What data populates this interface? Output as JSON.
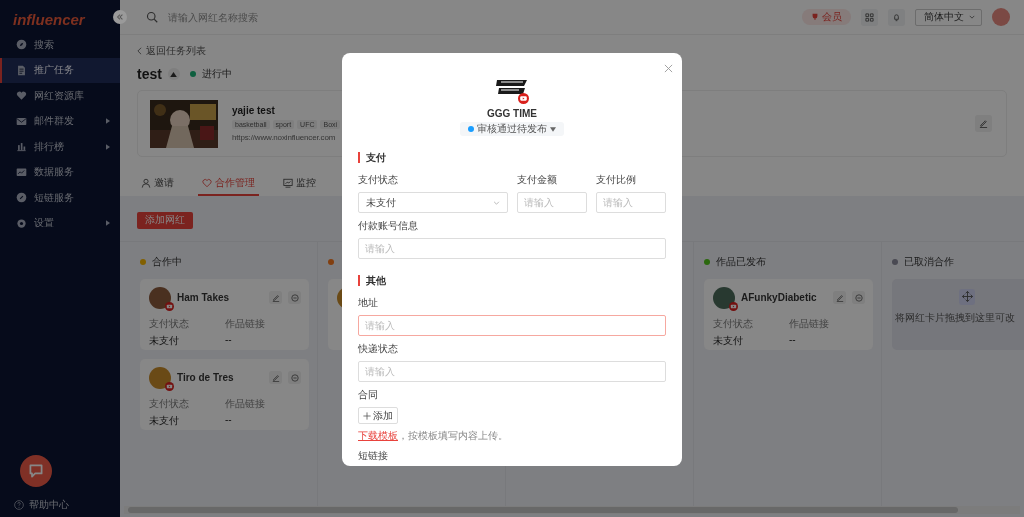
{
  "sidebar": {
    "logo": "influencer",
    "items": [
      {
        "label": "搜索",
        "selected": false,
        "has_submenu": false
      },
      {
        "label": "推广任务",
        "selected": true,
        "has_submenu": false
      },
      {
        "label": "网红资源库",
        "selected": false,
        "has_submenu": false
      },
      {
        "label": "邮件群发",
        "selected": false,
        "has_submenu": true
      },
      {
        "label": "排行榜",
        "selected": false,
        "has_submenu": true
      },
      {
        "label": "数据服务",
        "selected": false,
        "has_submenu": false
      },
      {
        "label": "短链服务",
        "selected": false,
        "has_submenu": false
      },
      {
        "label": "设置",
        "selected": false,
        "has_submenu": true
      }
    ],
    "help": "帮助中心"
  },
  "topbar": {
    "search": {
      "placeholder": "请输入网红名称搜索"
    },
    "member": "会员",
    "language": "简体中文"
  },
  "back_link": "返回任务列表",
  "task": {
    "title": "test",
    "status": "进行中"
  },
  "influencer_card": {
    "name": "yajie test",
    "tags": [
      "basketball",
      "sport",
      "UFC",
      "Boxi"
    ],
    "url": "https://www.noxinfluencer.com"
  },
  "tabs": [
    {
      "label": "邀请",
      "selected": false
    },
    {
      "label": "合作管理",
      "selected": true
    },
    {
      "label": "监控",
      "selected": false
    }
  ],
  "add_button": "添加网红",
  "columns": [
    {
      "kind": "open",
      "title": "合作中",
      "color": "#826000",
      "cards": [
        {
          "kind": "full",
          "name": "Ham Takes",
          "fields": [
            {
              "label": "支付状态",
              "value": "未支付"
            },
            {
              "label": "作品链接",
              "value": "--"
            }
          ]
        },
        {
          "kind": "full",
          "name": "Tiro de Tres",
          "fields": [
            {
              "label": "支付状态",
              "value": "未支付"
            },
            {
              "label": "作品链接",
              "value": "--"
            }
          ]
        }
      ]
    },
    {
      "kind": "open",
      "color": "#823f10",
      "cards": [
        {
          "kind": "covered"
        }
      ]
    },
    {
      "kind": "covered"
    },
    {
      "kind": "open",
      "title": "作品已发布",
      "color": "#2b680e",
      "cards": [
        {
          "kind": "full",
          "name": "AFunkyDiabetic",
          "fields": [
            {
              "label": "支付状态",
              "value": "未支付"
            },
            {
              "label": "作品链接",
              "value": "--"
            }
          ]
        }
      ]
    },
    {
      "kind": "drop",
      "title": "已取消合作",
      "color": "#4a4a53",
      "hint": "将网红卡片拖拽到这里可改"
    }
  ],
  "modal": {
    "channel_name": "GGG TIME",
    "status": "审核通过待发布",
    "sections": [
      {
        "title": "支付",
        "rows": [
          [
            {
              "kind": "select",
              "label": "支付状态",
              "value": "未支付",
              "highlighted": false
            },
            {
              "kind": "input",
              "label": "支付金额",
              "placeholder": "请输入",
              "highlighted": false
            },
            {
              "kind": "input",
              "label": "支付比例",
              "placeholder": "请输入",
              "highlighted": false
            }
          ],
          [
            {
              "kind": "input",
              "label": "付款账号信息",
              "placeholder": "请输入",
              "highlighted": false
            }
          ]
        ]
      },
      {
        "title": "其他",
        "rows": [
          [
            {
              "kind": "input",
              "label": "地址",
              "placeholder": "请输入",
              "highlighted": true
            }
          ],
          [
            {
              "kind": "input",
              "label": "快递状态",
              "placeholder": "请输入",
              "highlighted": false
            }
          ],
          [
            {
              "kind": "upload",
              "label": "合同",
              "button": "添加",
              "link": "下载模板",
              "note": "，按模板填写内容上传。"
            }
          ],
          [
            {
              "kind": "label",
              "label": "短链接"
            }
          ]
        ]
      }
    ]
  }
}
